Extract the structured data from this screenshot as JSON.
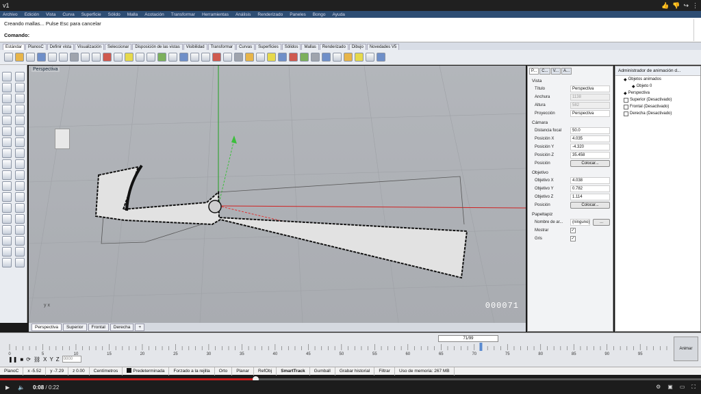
{
  "player": {
    "title": "v1",
    "current_time": "0:08",
    "duration": "0:22",
    "progress": 0.364,
    "top_icons": [
      "thumbs-up-icon",
      "thumbs-down-icon",
      "share-icon",
      "more-icon"
    ],
    "bottom_icons": [
      "play-icon",
      "volume-icon",
      "settings-icon",
      "youtube-icon",
      "miniplayer-icon",
      "fullscreen-icon"
    ]
  },
  "app": {
    "menu": [
      "Archivo",
      "Edición",
      "Vista",
      "Curva",
      "Superficie",
      "Sólido",
      "Malla",
      "Acotación",
      "Transformar",
      "Herramientas",
      "Análisis",
      "Renderizado",
      "Paneles",
      "Bongo",
      "Ayuda"
    ],
    "command_history": "Creando mallas... Pulse Esc para cancelar",
    "command_prompt": "Comando:",
    "toolbar_tabs": [
      "Estándar",
      "PlanosC",
      "Definir vista",
      "Visualización",
      "Seleccionar",
      "Disposición de las vistas",
      "Visibilidad",
      "Transformar",
      "Curvas",
      "Superficies",
      "Sólidos",
      "Mallas",
      "Renderizado",
      "Dibujo",
      "Novedades V5"
    ],
    "toolbar_tab_active": 0
  },
  "viewport": {
    "name": "Perspectiva",
    "frame_counter": "000071",
    "axis_label": "y x",
    "tabs": [
      "Perspectiva",
      "Superior",
      "Frontal",
      "Derecha"
    ],
    "active_tab": 0,
    "add_tab": "+"
  },
  "properties": {
    "tabs": [
      "P...",
      "C...",
      "V...",
      "A..."
    ],
    "active_tab": 0,
    "sections": {
      "vista": {
        "title": "Vista",
        "rows": [
          {
            "k": "Título",
            "v": "Perspectiva"
          },
          {
            "k": "Anchura",
            "v": "1138",
            "dim": true
          },
          {
            "k": "Altura",
            "v": "582",
            "dim": true
          },
          {
            "k": "Proyección",
            "v": "Perspectiva"
          }
        ]
      },
      "camara": {
        "title": "Cámara",
        "rows": [
          {
            "k": "Distancia focal",
            "v": "50.0"
          },
          {
            "k": "Posición X",
            "v": "4.035"
          },
          {
            "k": "Posición Y",
            "v": "-4.320"
          },
          {
            "k": "Posición Z",
            "v": "35.458"
          }
        ],
        "button_label": "Posición",
        "button": "Colocar..."
      },
      "objetivo": {
        "title": "Objetivo",
        "rows": [
          {
            "k": "Objetivo X",
            "v": "4.038"
          },
          {
            "k": "Objetivo Y",
            "v": "0.782"
          },
          {
            "k": "Objetivo Z",
            "v": "1.114"
          }
        ],
        "button_label": "Posición",
        "button": "Colocar..."
      },
      "papeltapiz": {
        "title": "Papeltapiz",
        "name_label": "Nombre de ar...",
        "name_value": "(ninguno)",
        "browse": "...",
        "show_label": "Mostrar",
        "gray_label": "Gris",
        "check": "✓"
      }
    }
  },
  "animation": {
    "title": "Administrador de animación d...",
    "items": [
      {
        "label": "Objetos animados",
        "level": 1,
        "kind": "icon",
        "icon": "animated-objects-icon"
      },
      {
        "label": "Objeto 0",
        "level": 2,
        "kind": "icon",
        "icon": "object-icon"
      },
      {
        "label": "Perspectiva",
        "level": 1,
        "kind": "icon",
        "icon": "perspective-view-icon"
      },
      {
        "label": "Superior (Desactivado)",
        "level": 1,
        "kind": "box"
      },
      {
        "label": "Frontal (Desactivado)",
        "level": 1,
        "kind": "box"
      },
      {
        "label": "Derecha (Desactivado)",
        "level": 1,
        "kind": "box"
      }
    ]
  },
  "timeline": {
    "frame_display": "71/99",
    "current_frame": 71,
    "total_frames": 99,
    "tick_labels": [
      "0",
      "5",
      "10",
      "15",
      "20",
      "25",
      "30",
      "35",
      "40",
      "45",
      "50",
      "55",
      "60",
      "65",
      "70",
      "75",
      "80",
      "85",
      "90",
      "95"
    ],
    "animate_button": "Animar",
    "frame_input": "0000",
    "controls": [
      "pause-icon",
      "stop-icon",
      "loop-icon",
      "link-icon",
      "x-icon",
      "y-icon",
      "z-icon"
    ]
  },
  "status": {
    "items": [
      {
        "label": "PlanoC",
        "bold": false
      },
      {
        "label": "x -5.52",
        "bold": false
      },
      {
        "label": "y -7.29",
        "bold": false
      },
      {
        "label": "z 0.00",
        "bold": false
      },
      {
        "label": "Centímetros",
        "bold": false
      },
      {
        "label": "Predeterminada",
        "bold": false,
        "swatch": true
      },
      {
        "label": "Forzado a la rejilla",
        "bold": false
      },
      {
        "label": "Orto",
        "bold": false
      },
      {
        "label": "Planar",
        "bold": false
      },
      {
        "label": "RefObj",
        "bold": false
      },
      {
        "label": "SmartTrack",
        "bold": true
      },
      {
        "label": "Gumball",
        "bold": false
      },
      {
        "label": "Grabar historial",
        "bold": false
      },
      {
        "label": "Filtrar",
        "bold": false
      },
      {
        "label": "Uso de memoria: 267 MB",
        "bold": false
      }
    ]
  },
  "colors": {
    "menubar": "#2d4d73",
    "viewport_bg": "#b0b3b8",
    "x_axis": "#d02020",
    "y_axis": "#20a020",
    "progress": "#cc1e1e"
  }
}
